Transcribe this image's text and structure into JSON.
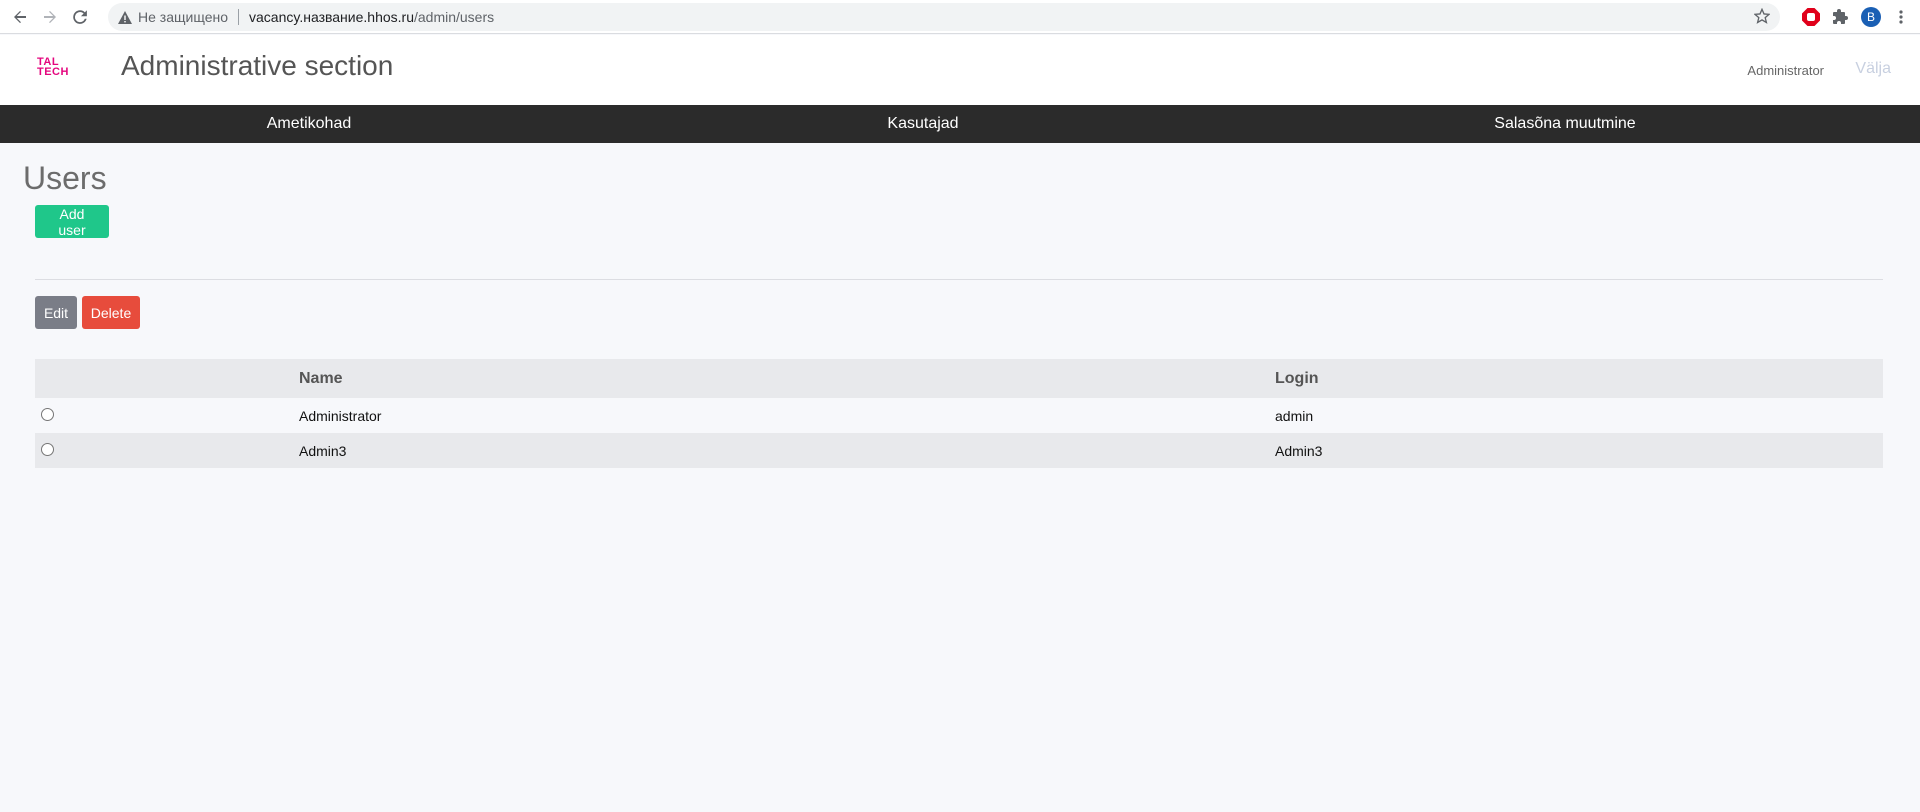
{
  "browser": {
    "security_label": "Не защищено",
    "url_host": "vacancy.название.hhos.ru",
    "url_path": "/admin/users",
    "profile_initial": "B"
  },
  "header": {
    "logo_line1": "TAL",
    "logo_line2": "TECH",
    "title": "Administrative section",
    "user_name": "Administrator",
    "logout_label": "Välja"
  },
  "nav": {
    "items": [
      {
        "label": "Ametikohad"
      },
      {
        "label": "Kasutajad"
      },
      {
        "label": "Salasõna muutmine"
      }
    ]
  },
  "page": {
    "title": "Users",
    "add_button": "Add user",
    "edit_button": "Edit",
    "delete_button": "Delete"
  },
  "table": {
    "headers": [
      "",
      "Name",
      "Login"
    ],
    "rows": [
      {
        "name": "Administrator",
        "login": "admin"
      },
      {
        "name": "Admin3",
        "login": "Admin3"
      }
    ]
  },
  "colors": {
    "accent_green": "#1fc78a",
    "danger_red": "#e74c3c",
    "nav_bg": "#2b2b2b",
    "brand_pink": "#e4067e"
  }
}
